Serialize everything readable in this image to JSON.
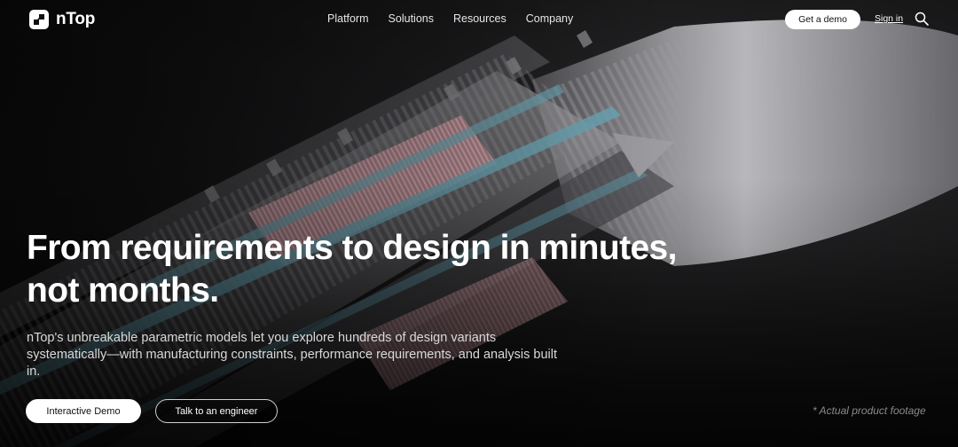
{
  "brand": {
    "name": "nTop",
    "logo_icon": "ntop-logo-icon"
  },
  "nav": {
    "items": [
      {
        "label": "Platform"
      },
      {
        "label": "Solutions"
      },
      {
        "label": "Resources"
      },
      {
        "label": "Company"
      }
    ],
    "demo_label": "Get a demo",
    "signin_label": "Sign in",
    "search_icon": "search-icon"
  },
  "hero": {
    "headline_line1": "From requirements to design in minutes,",
    "headline_line2": "not months.",
    "subtext": "nTop's unbreakable parametric models let you explore hundreds of design variants systematically—with manufacturing constraints, performance requirements, and analysis built in.",
    "primary_cta": "Interactive Demo",
    "secondary_cta": "Talk to an engineer",
    "footnote": "* Actual product footage"
  },
  "colors": {
    "background": "#0b0b0c",
    "accent_teal": "#6fa9b8",
    "accent_pink": "#d59aa2",
    "metal": "#8c8c90"
  }
}
